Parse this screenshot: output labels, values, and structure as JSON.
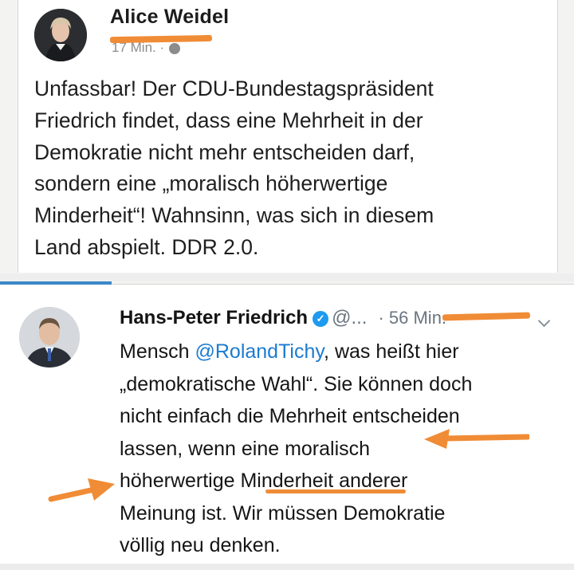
{
  "top_post": {
    "author": "Alice Weidel",
    "meta": "17 Min. ·",
    "lines": [
      "Unfassbar! Der CDU-Bundestagspräsident",
      "Friedrich findet, dass eine Mehrheit in der",
      "Demokratie nicht mehr entscheiden darf,",
      "sondern eine „moralisch höherwertige",
      "Minderheit“! Wahnsinn, was sich in diesem",
      "Land abspielt. DDR 2.0."
    ]
  },
  "tweet": {
    "name": "Hans-Peter Friedrich",
    "handle": "@...",
    "time": "· 56 Min.",
    "line1_prefix": "Mensch ",
    "mention": "@RolandTichy",
    "line1_suffix": ", was heißt hier",
    "lines": [
      "„demokratische Wahl“. Sie können doch",
      "nicht einfach die Mehrheit entscheiden",
      "lassen, wenn eine moralisch",
      "höherwertige Minderheit anderer",
      "Meinung ist. Wir müssen Demokratie",
      "völlig neu denken."
    ]
  },
  "colors": {
    "annotation": "#f08c36",
    "link": "#1b7bd0",
    "verified": "#1d9bf0",
    "tab_underline": "#3a88c8"
  },
  "icons": [
    "globe-icon",
    "verified-badge-icon",
    "chevron-down-icon",
    "arrow-annotation"
  ]
}
